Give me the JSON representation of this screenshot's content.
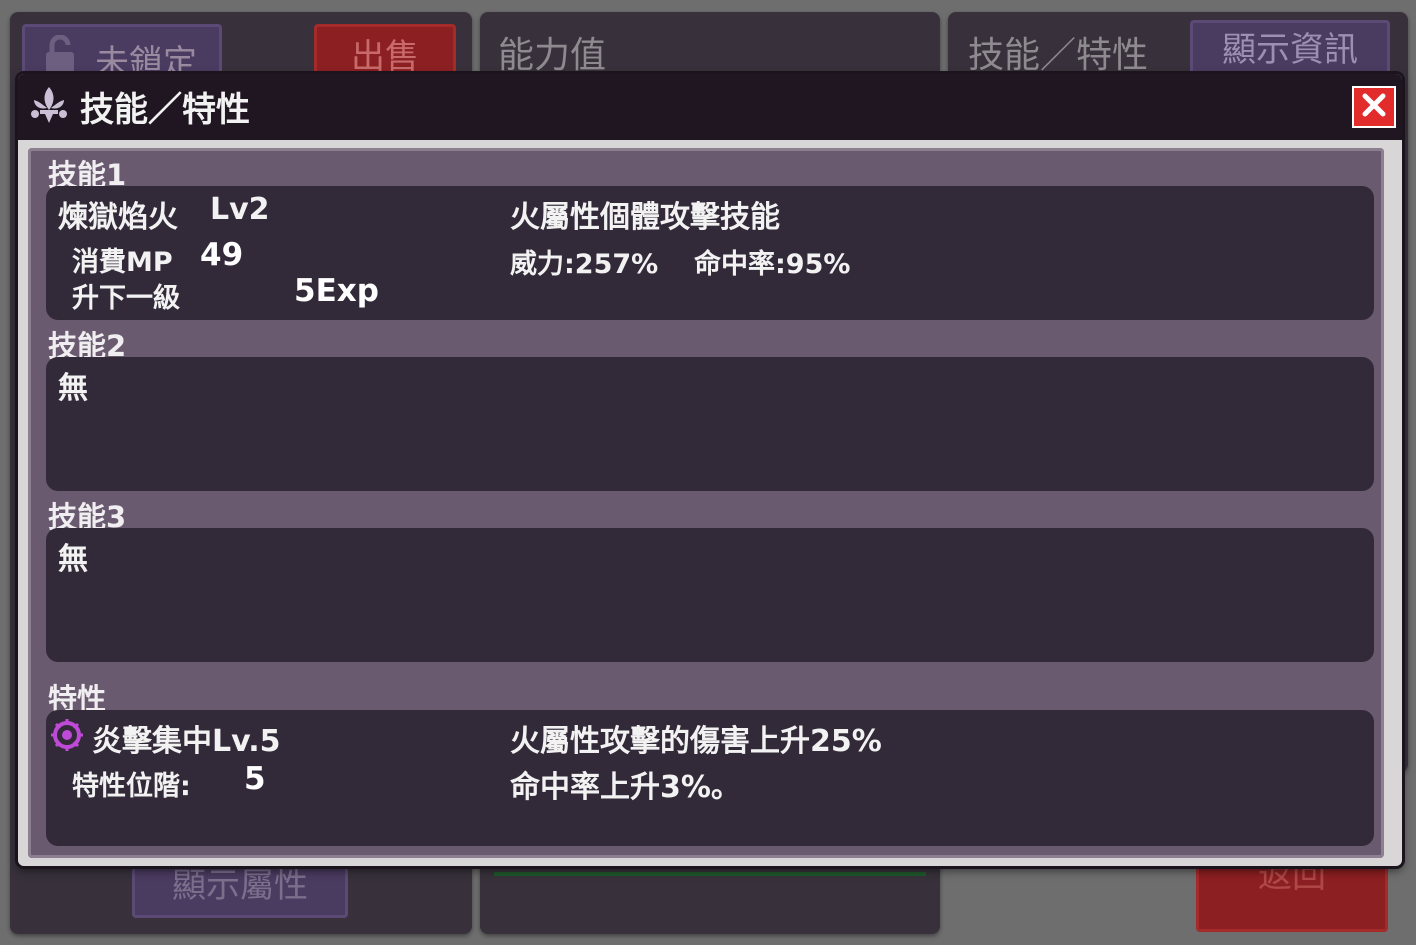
{
  "background": {
    "lock_label": "未鎖定",
    "sell_label": "出售",
    "stats_title": "能力值",
    "skills_title": "技能／特性",
    "show_info_label": "顯示資訊",
    "show_attr_label": "顯示屬性",
    "return_label": "返回"
  },
  "modal": {
    "title": "技能／特性",
    "icon": "fleur-de-lis-icon",
    "close_icon": "close-icon"
  },
  "skills": [
    {
      "label": "技能1",
      "name": "煉獄焰火",
      "level": "Lv2",
      "mp_label": "消費MP",
      "mp_value": "49",
      "next_label": "升下一級",
      "next_value": "5Exp",
      "description": "火屬性個體攻擊技能",
      "power": "威力:257%",
      "accuracy": "命中率:95%"
    },
    {
      "label": "技能2",
      "name": "無"
    },
    {
      "label": "技能3",
      "name": "無"
    }
  ],
  "trait": {
    "label": "特性",
    "icon": "flame-emblem-icon",
    "name": "炎擊集中Lv.5",
    "rank_label": "特性位階:",
    "rank_value": "5",
    "desc_line1": "火屬性攻擊的傷害上升25%",
    "desc_line2": "命中率上升3%。"
  },
  "colors": {
    "accent_purple": "#4a3b60",
    "close_red": "#e22b2b",
    "panel_dark": "#332a39"
  }
}
